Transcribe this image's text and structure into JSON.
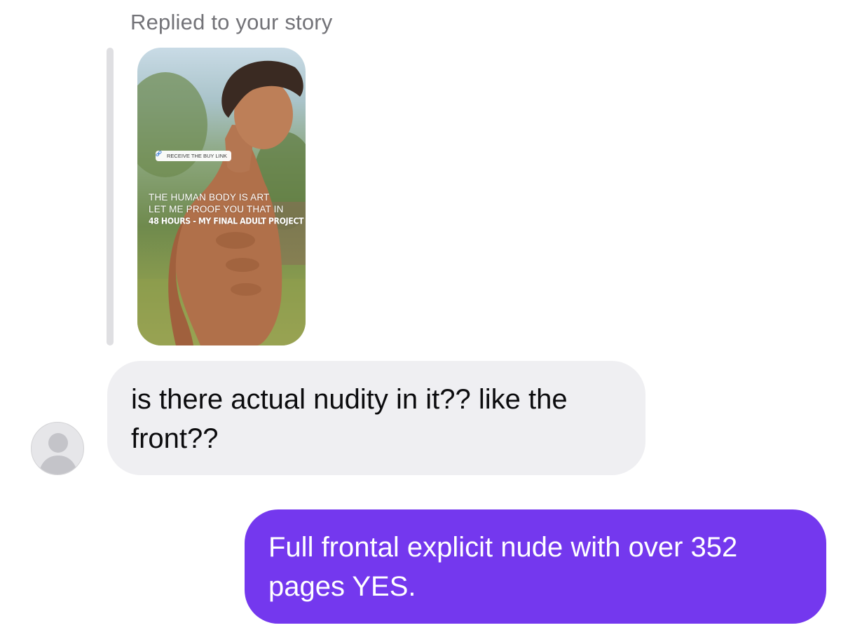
{
  "reply_header": "Replied to your story",
  "story": {
    "buy_link_label": "RECEIVE THE BUY LINK",
    "link_icon": "link-icon",
    "caption_lines": [
      "THE HUMAN BODY IS ART",
      "LET ME PROOF YOU THAT IN",
      "48 HOURS - MY FINAL ADULT PROJECT"
    ]
  },
  "conversation": {
    "incoming_message": "is there actual nudity in it?? like the front??",
    "outgoing_message": "Full frontal explicit nude with over 352 pages YES.",
    "avatar_icon": "default-profile-icon"
  },
  "colors": {
    "outgoing_bubble": "#7438ee",
    "incoming_bubble": "#efeff2",
    "reply_header_text": "#737378"
  }
}
